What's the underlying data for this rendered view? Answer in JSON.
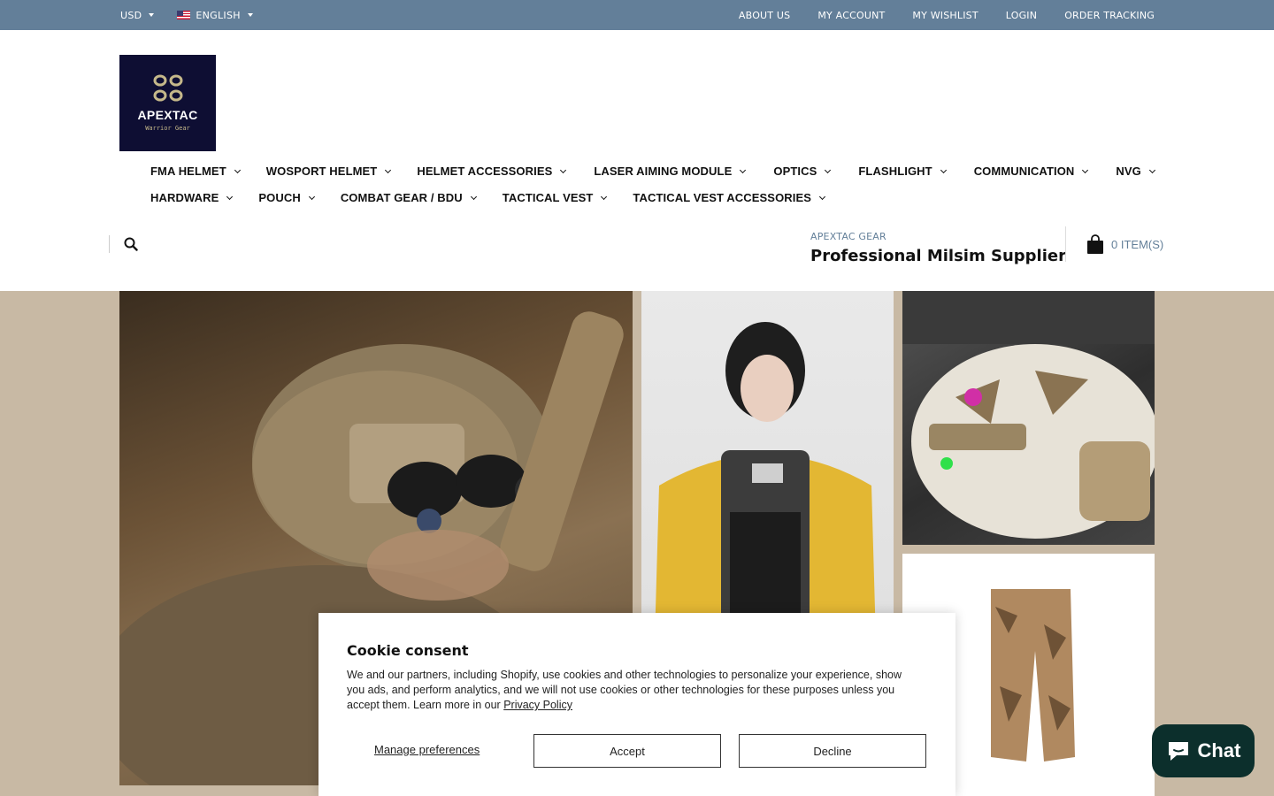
{
  "topbar": {
    "currency": "USD",
    "language": "ENGLISH",
    "links": [
      "ABOUT US",
      "MY ACCOUNT",
      "MY WISHLIST",
      "LOGIN",
      "ORDER TRACKING"
    ]
  },
  "logo": {
    "brand": "APEXTAC",
    "tagline": "Warrior Gear"
  },
  "nav": {
    "row1": [
      "FMA HELMET",
      "WOSPORT HELMET",
      "HELMET ACCESSORIES",
      "LASER AIMING MODULE",
      "OPTICS",
      "FLASHLIGHT",
      "COMMUNICATION",
      "NVG"
    ],
    "row2": [
      "HARDWARE",
      "POUCH",
      "COMBAT GEAR / BDU",
      "TACTICAL VEST",
      "TACTICAL VEST ACCESSORIES"
    ]
  },
  "header": {
    "tagline_small": "APEXTAC GEAR",
    "tagline_big": "Professional Milsim Supplier",
    "cart_label": "0 ITEM(S)"
  },
  "cookie": {
    "title": "Cookie consent",
    "body": "We and our partners, including Shopify, use cookies and other technologies to personalize your experience, show you ads, and perform analytics, and we will not use cookies or other technologies for these purposes unless you accept them. Learn more in our",
    "privacy_link": "Privacy Policy",
    "manage": "Manage preferences",
    "accept": "Accept",
    "decline": "Decline"
  },
  "chat": {
    "label": "Chat"
  },
  "colors": {
    "topbar": "#637f99",
    "hero_bg": "#c8b9a4",
    "chat": "#0c2f2c",
    "logo_bg": "#0e0e33"
  }
}
